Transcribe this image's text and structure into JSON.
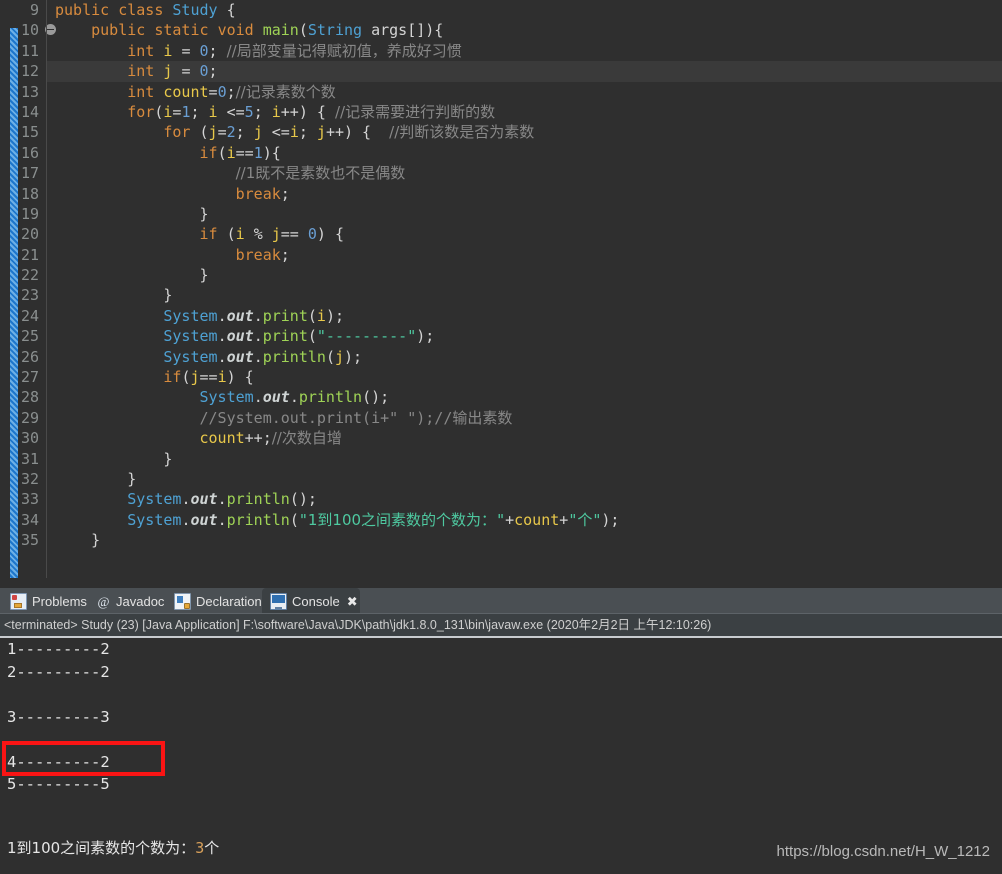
{
  "editor": {
    "first_line_number": 9,
    "current_line_number": 12,
    "fold_line_number": 10,
    "lines": [
      {
        "n": "9",
        "text": "public class Study {"
      },
      {
        "n": "10",
        "text": "    public static void main(String args[]){"
      },
      {
        "n": "11",
        "text": "        int i = 0; //局部变量记得赋初值，养成好习惯"
      },
      {
        "n": "12",
        "text": "        int j = 0;"
      },
      {
        "n": "13",
        "text": "        int count=0;//记录素数个数"
      },
      {
        "n": "14",
        "text": "        for(i=1; i <=5; i++) { //记录需要进行判断的数"
      },
      {
        "n": "15",
        "text": "            for (j=2; j <=i; j++) {  //判断该数是否为素数"
      },
      {
        "n": "16",
        "text": "                if(i==1){"
      },
      {
        "n": "17",
        "text": "                    //1既不是素数也不是偶数"
      },
      {
        "n": "18",
        "text": "                    break;"
      },
      {
        "n": "19",
        "text": "                }"
      },
      {
        "n": "20",
        "text": "                if (i % j== 0) {"
      },
      {
        "n": "21",
        "text": "                    break;"
      },
      {
        "n": "22",
        "text": "                }"
      },
      {
        "n": "23",
        "text": "            }"
      },
      {
        "n": "24",
        "text": "            System.out.print(i);"
      },
      {
        "n": "25",
        "text": "            System.out.print(\"---------\");"
      },
      {
        "n": "26",
        "text": "            System.out.println(j);"
      },
      {
        "n": "27",
        "text": "            if(j==i) {"
      },
      {
        "n": "28",
        "text": "                System.out.println();"
      },
      {
        "n": "29",
        "text": "                //System.out.print(i+\" \");//输出素数"
      },
      {
        "n": "30",
        "text": "                count++;//次数自增"
      },
      {
        "n": "31",
        "text": "            }"
      },
      {
        "n": "32",
        "text": "        }"
      },
      {
        "n": "33",
        "text": "        System.out.println();"
      },
      {
        "n": "34",
        "text": "        System.out.println(\"1到100之间素数的个数为：\"+count+\"个\");"
      },
      {
        "n": "35",
        "text": "    }"
      }
    ]
  },
  "view_tabs": [
    {
      "label": "Problems",
      "icon": "problems-icon",
      "active": false,
      "closable": false
    },
    {
      "label": "Javadoc",
      "icon": "javadoc-icon",
      "active": false,
      "closable": false
    },
    {
      "label": "Declaration",
      "icon": "declaration-icon",
      "active": false,
      "closable": false
    },
    {
      "label": "Console",
      "icon": "console-icon",
      "active": true,
      "closable": true
    }
  ],
  "console": {
    "status_line": "<terminated> Study (23) [Java Application] F:\\software\\Java\\JDK\\path\\jdk1.8.0_131\\bin\\javaw.exe (2020年2月2日 上午12:10:26)",
    "output_lines": [
      "1---------2",
      "2---------2",
      "",
      "3---------3",
      "",
      "4---------2",
      "5---------5"
    ],
    "summary_prefix": "1到100之间素数的个数为：",
    "summary_count": "3",
    "summary_suffix": "个",
    "highlight_box_target": "4---------2",
    "highlight_color": "#fa1414"
  },
  "watermark": "https://blog.csdn.net/H_W_1212"
}
